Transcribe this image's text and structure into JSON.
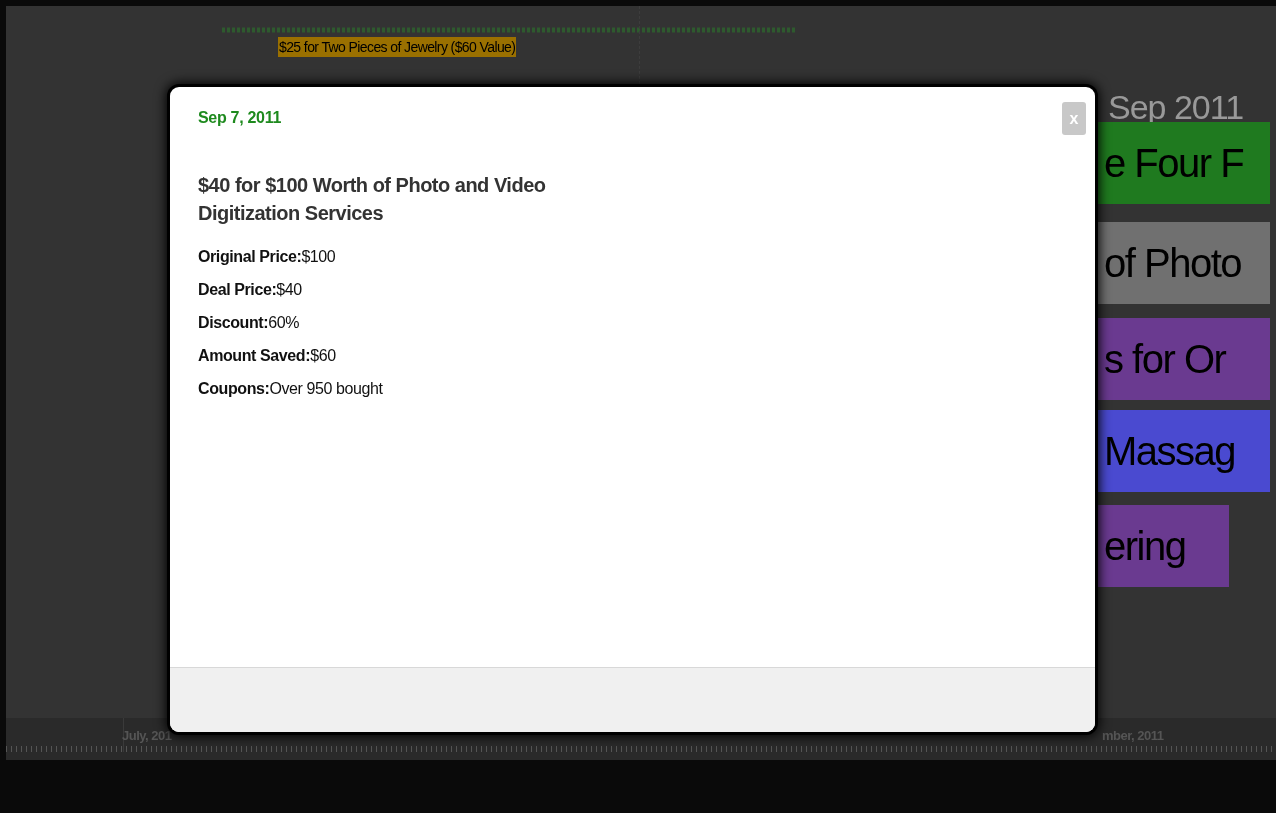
{
  "timeline": {
    "top_event": {
      "label": "$25 for Two Pieces of Jewelry ($60 Value)",
      "color": "#9a7000"
    },
    "month_heading": "Sep 2011",
    "events": [
      {
        "label": "e Four F",
        "color": "#1f7a1f"
      },
      {
        "label": "of Photo",
        "color": "#707070"
      },
      {
        "label": "s for Or",
        "color": "#6a3a90"
      },
      {
        "label": "Massag",
        "color": "#4a4ad0"
      },
      {
        "label": "ering",
        "color": "#6a3a90"
      }
    ],
    "axis_labels": [
      "July, 201",
      "mber, 2011"
    ]
  },
  "modal": {
    "date": "Sep 7, 2011",
    "title": "$40 for $100 Worth of Photo and Video Digitization Services",
    "close": "x",
    "details": [
      {
        "label": "Original Price:",
        "value": "$100"
      },
      {
        "label": "Deal Price:",
        "value": "$40"
      },
      {
        "label": "Discount:",
        "value": "60%"
      },
      {
        "label": "Amount Saved:",
        "value": "$60"
      },
      {
        "label": "Coupons:",
        "value": "Over 950 bought"
      }
    ]
  }
}
